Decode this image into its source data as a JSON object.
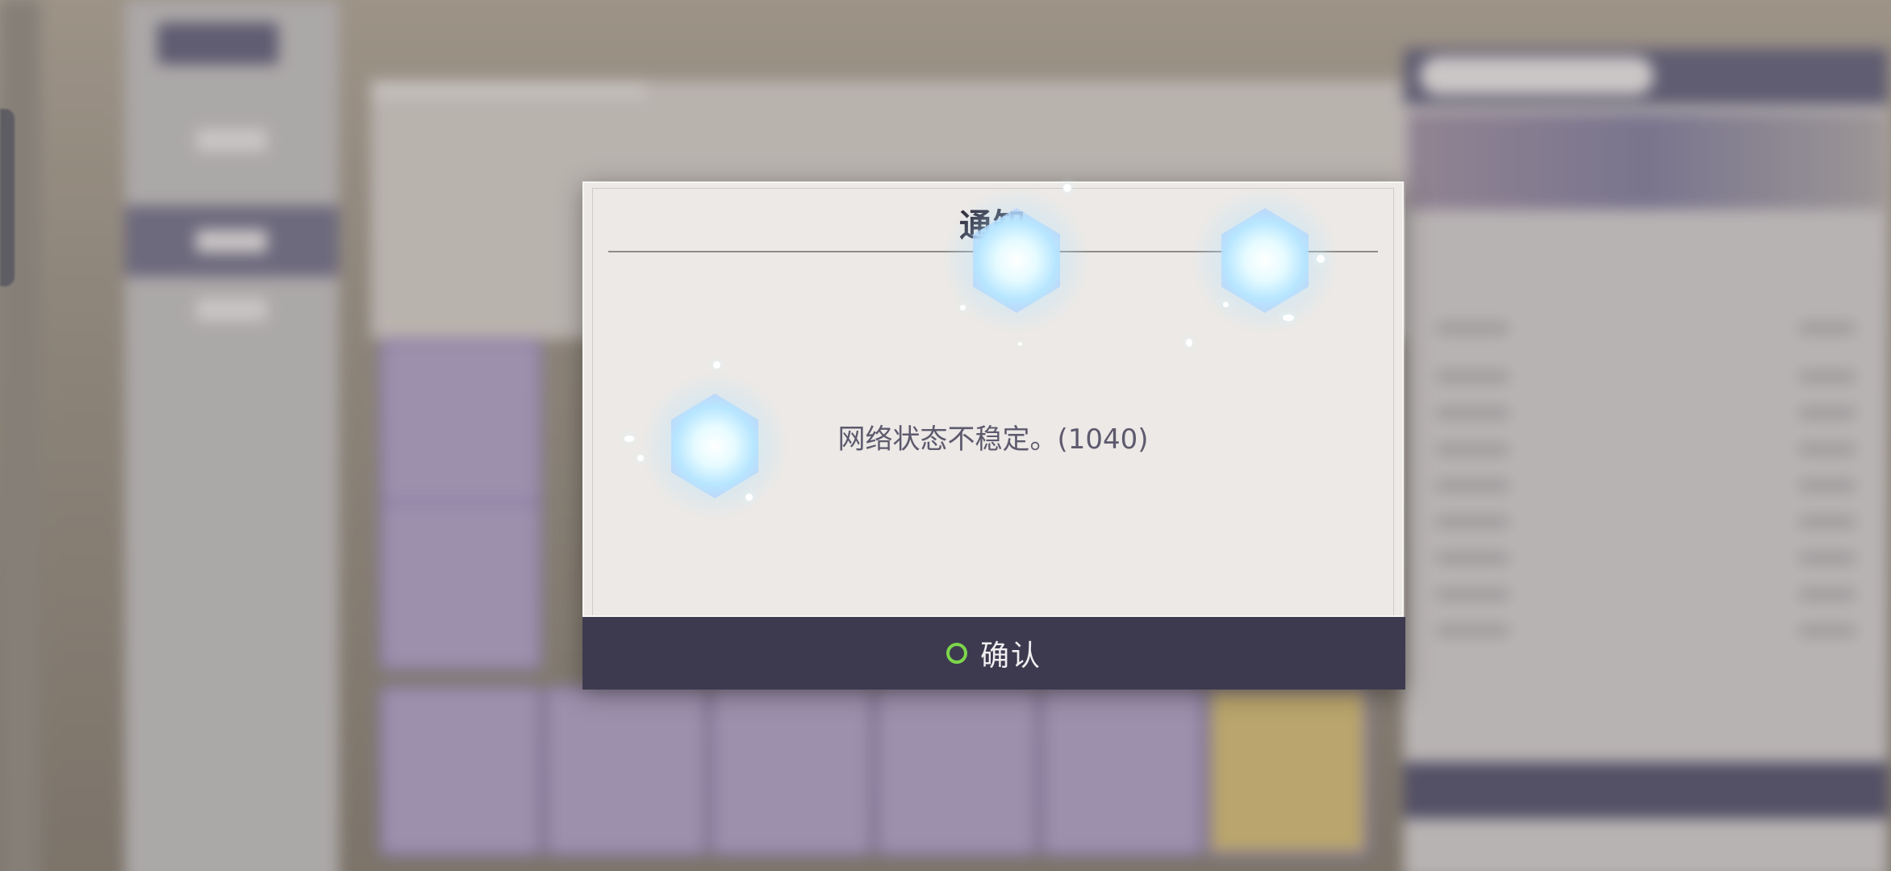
{
  "dialog": {
    "title": "通知",
    "message": "网络状态不稳定。(1040)",
    "confirm_label": "确认"
  },
  "icons": {
    "confirm": "circle-icon",
    "decor": "crystal-icon"
  },
  "colors": {
    "dialog_background": "#ece9e6",
    "title_text": "#2e2b3c",
    "message_text": "#5d5a6e",
    "confirm_bar": "#3d3a4f",
    "confirm_circle": "#7cd64a",
    "crystal_glow": "#c8f4ff"
  }
}
